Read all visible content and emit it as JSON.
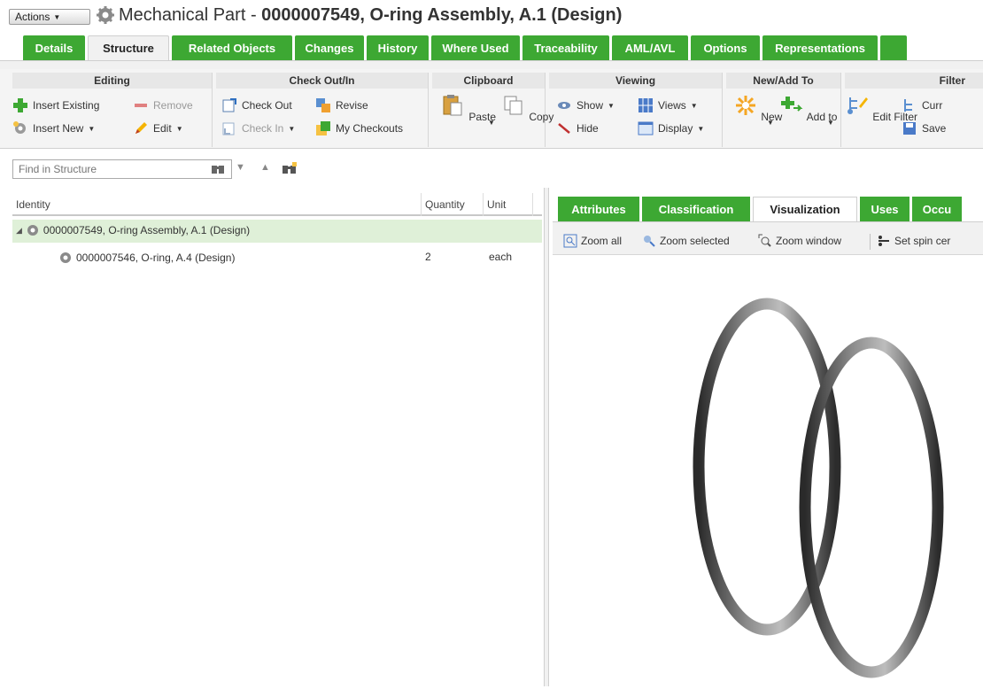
{
  "header": {
    "actions_label": "Actions",
    "title_prefix": "Mechanical Part - ",
    "title_bold": "0000007549, O-ring Assembly, A.1 (Design)"
  },
  "main_tabs": [
    {
      "label": "Details"
    },
    {
      "label": "Structure"
    },
    {
      "label": "Related Objects"
    },
    {
      "label": "Changes"
    },
    {
      "label": "History"
    },
    {
      "label": "Where Used"
    },
    {
      "label": "Traceability"
    },
    {
      "label": "AML/AVL"
    },
    {
      "label": "Options"
    },
    {
      "label": "Representations"
    }
  ],
  "ribbon": {
    "editing": {
      "title": "Editing",
      "insert_existing": "Insert Existing",
      "remove": "Remove",
      "insert_new": "Insert New",
      "edit": "Edit"
    },
    "checkout": {
      "title": "Check Out/In",
      "check_out": "Check Out",
      "revise": "Revise",
      "check_in": "Check In",
      "my_checkouts": "My Checkouts"
    },
    "clipboard": {
      "title": "Clipboard",
      "paste": "Paste",
      "copy": "Copy"
    },
    "viewing": {
      "title": "Viewing",
      "show": "Show",
      "views": "Views",
      "hide": "Hide",
      "display": "Display"
    },
    "new_add": {
      "title": "New/Add To",
      "new": "New",
      "add_to": "Add to"
    },
    "filter": {
      "title": "Filter",
      "edit_filter": "Edit Filter",
      "current": "Curr",
      "save": "Save"
    }
  },
  "find": {
    "placeholder": "Find in Structure"
  },
  "tree": {
    "columns": {
      "identity": "Identity",
      "quantity": "Quantity",
      "unit": "Unit"
    },
    "rows": [
      {
        "identity": "0000007549, O-ring Assembly, A.1 (Design)",
        "quantity": "",
        "unit": ""
      },
      {
        "identity": "0000007546, O-ring, A.4 (Design)",
        "quantity": "2",
        "unit": "each"
      }
    ]
  },
  "right_tabs": [
    {
      "label": "Attributes"
    },
    {
      "label": "Classification"
    },
    {
      "label": "Visualization"
    },
    {
      "label": "Uses"
    },
    {
      "label": "Occu"
    }
  ],
  "viz_toolbar": {
    "zoom_all": "Zoom all",
    "zoom_selected": "Zoom selected",
    "zoom_window": "Zoom window",
    "set_spin": "Set spin cer"
  },
  "colors": {
    "tab_green": "#3da833",
    "selected_row": "#dff0d8"
  }
}
